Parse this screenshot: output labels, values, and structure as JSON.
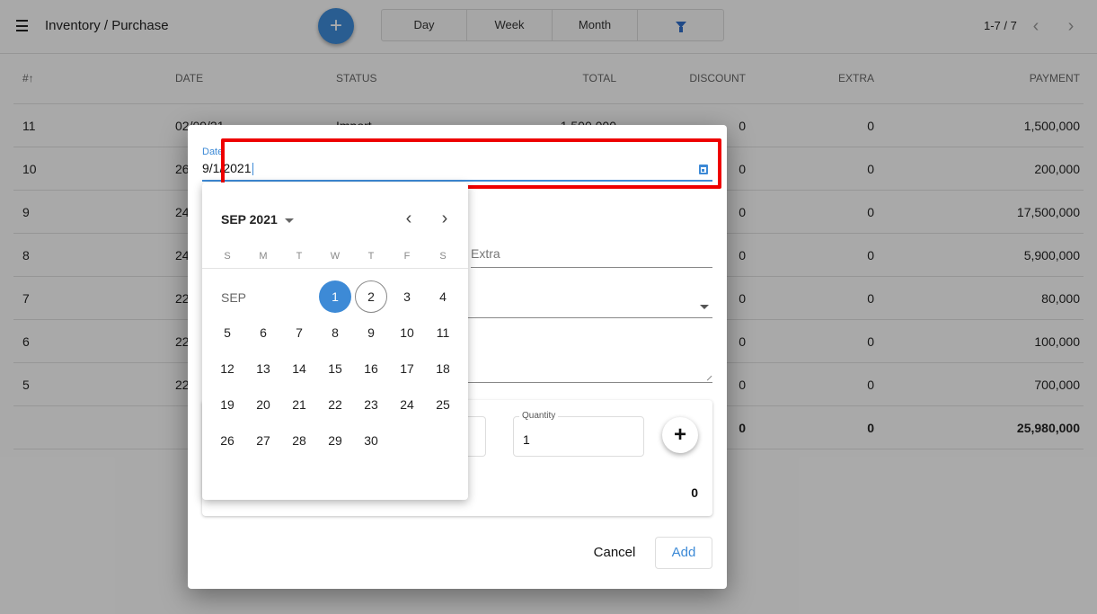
{
  "app": {
    "title": "Inventory / Purchase",
    "add_icon": "plus-icon"
  },
  "toolbar": {
    "segments": [
      {
        "label": "Day"
      },
      {
        "label": "Week"
      },
      {
        "label": "Month"
      },
      {
        "label": "",
        "icon": "filter-icon"
      }
    ],
    "pager_text": "1-7 / 7",
    "prev_icon": "‹",
    "next_icon": "›"
  },
  "table": {
    "columns": [
      "#↑",
      "DATE",
      "STATUS",
      "TOTAL",
      "DISCOUNT",
      "EXTRA",
      "PAYMENT"
    ],
    "rows": [
      {
        "id": "11",
        "date": "02/09/21",
        "status": "Import",
        "total": "1,500,000",
        "discount": "0",
        "extra": "0",
        "payment": "1,500,000"
      },
      {
        "id": "10",
        "date": "26",
        "status": "",
        "total": "",
        "discount": "0",
        "extra": "0",
        "payment": "200,000"
      },
      {
        "id": "9",
        "date": "24",
        "status": "",
        "total": "",
        "discount": "0",
        "extra": "0",
        "payment": "17,500,000"
      },
      {
        "id": "8",
        "date": "24",
        "status": "",
        "total": "",
        "discount": "0",
        "extra": "0",
        "payment": "5,900,000"
      },
      {
        "id": "7",
        "date": "22",
        "status": "",
        "total": "",
        "discount": "0",
        "extra": "0",
        "payment": "80,000"
      },
      {
        "id": "6",
        "date": "22",
        "status": "",
        "total": "",
        "discount": "0",
        "extra": "0",
        "payment": "100,000"
      },
      {
        "id": "5",
        "date": "22",
        "status": "",
        "total": "",
        "discount": "0",
        "extra": "0",
        "payment": "700,000"
      }
    ],
    "totals": {
      "discount": "0",
      "extra": "0",
      "payment": "25,980,000"
    }
  },
  "dialog": {
    "date_label": "Date",
    "date_value": "9/1/2021",
    "extra_placeholder": "Extra",
    "quantity_label": "Quantity",
    "quantity_value": "1",
    "items_total": "0",
    "cancel_label": "Cancel",
    "add_label": "Add"
  },
  "calendar": {
    "header": "SEP 2021",
    "month_short": "SEP",
    "weekdays": [
      "S",
      "M",
      "T",
      "W",
      "T",
      "F",
      "S"
    ],
    "first_weekday_index": 3,
    "days_in_month": 30,
    "selected_day": 1,
    "today_day": 2,
    "prev_icon": "‹",
    "next_icon": "›"
  },
  "colors": {
    "accent": "#3d8ad6",
    "highlight": "#ee0000"
  }
}
